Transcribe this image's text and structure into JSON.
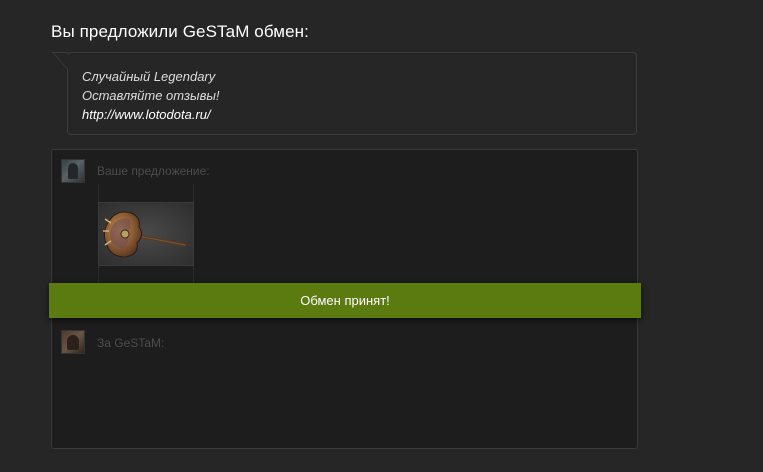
{
  "header": {
    "title": "Вы предложили GeSTaM обмен:"
  },
  "message": {
    "lines": [
      "Случайный Legendary",
      "Оставляйте отзывы!",
      "http://www.lotodota.ru/"
    ]
  },
  "trade": {
    "your_offer_label": "Ваше предложение:",
    "their_offer_label": "За GeSTaM:",
    "items_yours": [
      {
        "icon": "battle-axe-icon"
      }
    ],
    "items_theirs": []
  },
  "status": {
    "text": "Обмен принят!",
    "color": "#5b7a10"
  },
  "colors": {
    "background": "#262626",
    "panel": "#1d1d1d",
    "accent": "#5b7a10"
  }
}
